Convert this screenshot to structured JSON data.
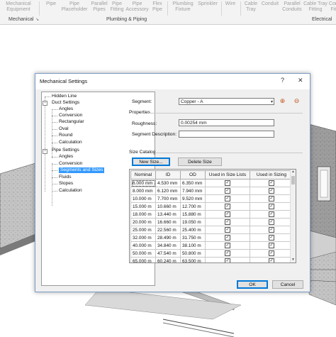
{
  "ribbon": {
    "buttons": [
      {
        "label": "Mechanical\nEquipment"
      },
      {
        "label": "Pipe"
      },
      {
        "label": "Pipe\nPlaceholder"
      },
      {
        "label": "Parallel\nPipes"
      },
      {
        "label": "Pipe\nFitting"
      },
      {
        "label": "Pipe\nAccessory"
      },
      {
        "label": "Flex\nPipe"
      },
      {
        "label": "Plumbing\nFixture"
      },
      {
        "label": "Sprinkler"
      },
      {
        "label": "Wire"
      },
      {
        "label": "Cable\nTray"
      },
      {
        "label": "Conduit"
      },
      {
        "label": "Parallel\nConduits"
      },
      {
        "label": "Cable Tray\nFitting"
      },
      {
        "label": "Conduit\nFitting"
      }
    ],
    "groups": {
      "mechanical": "Mechanical",
      "plumbing": "Plumbing & Piping",
      "electrical": "Electrical"
    }
  },
  "dialog": {
    "title": "Mechanical Settings",
    "help": "?",
    "close": "✕",
    "tree": {
      "hidden_line": "Hidden Line",
      "duct_settings": "Duct Settings",
      "angles": "Angles",
      "conversion": "Conversion",
      "rectangular": "Rectangular",
      "oval": "Oval",
      "round": "Round",
      "calculation": "Calculation",
      "pipe_settings": "Pipe Settings",
      "pipe_angles": "Angles",
      "pipe_conversion": "Conversion",
      "segments_and_sizes": "Segments and Sizes",
      "fluids": "Fluids",
      "slopes": "Slopes",
      "pipe_calculation": "Calculation"
    },
    "segment_label": "Segment:",
    "segment_value": "Copper - A",
    "properties_label": "Properties",
    "roughness_label": "Roughness:",
    "roughness_value": "0.00254 mm",
    "segment_description_label": "Segment Description:",
    "segment_description_value": "",
    "size_catalog_label": "Size Catalog",
    "new_size_button": "New Size...",
    "delete_size_button": "Delete Size",
    "columns": [
      "Nominal",
      "ID",
      "OD",
      "Used in Size Lists",
      "Used in Sizing"
    ],
    "rows": [
      {
        "nominal": "6.000 mm",
        "id": "4.530 mm",
        "od": "6.350 mm"
      },
      {
        "nominal": "8.000 mm",
        "id": "6.120 mm",
        "od": "7.940 mm"
      },
      {
        "nominal": "10.000 m",
        "id": "7.700 mm",
        "od": "9.520 mm"
      },
      {
        "nominal": "15.000 m",
        "id": "10.660 m",
        "od": "12.700 m"
      },
      {
        "nominal": "18.000 m",
        "id": "13.440 m",
        "od": "15.880 m"
      },
      {
        "nominal": "20.000 m",
        "id": "16.660 m",
        "od": "19.050 m"
      },
      {
        "nominal": "25.000 m",
        "id": "22.560 m",
        "od": "25.400 m"
      },
      {
        "nominal": "32.000 m",
        "id": "28.490 m",
        "od": "31.750 m"
      },
      {
        "nominal": "40.000 m",
        "id": "34.840 m",
        "od": "38.100 m"
      },
      {
        "nominal": "50.000 m",
        "id": "47.540 m",
        "od": "50.800 m"
      },
      {
        "nominal": "65.000 m",
        "id": "60.240 m",
        "od": "63.500 m"
      }
    ],
    "ok_button": "OK",
    "cancel_button": "Cancel"
  }
}
